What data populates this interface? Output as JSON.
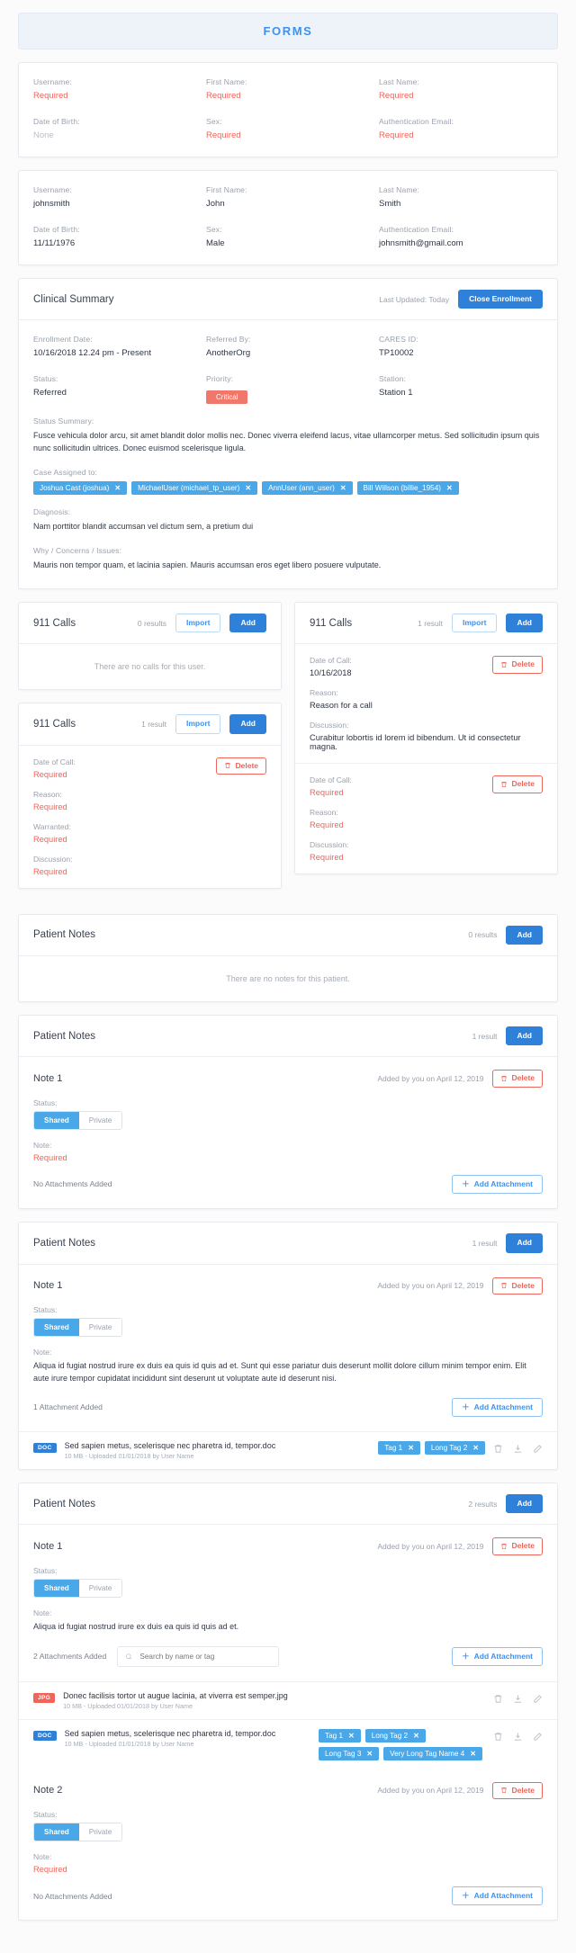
{
  "banner": {
    "title": "FORMS"
  },
  "colors": {
    "accent": "#2f80d8",
    "light_blue": "#4aa8e8",
    "danger": "#f0655a",
    "muted": "#9aa1ad"
  },
  "form_empty": {
    "fields": [
      {
        "label": "Username:",
        "value": "Required",
        "state": "required"
      },
      {
        "label": "First Name:",
        "value": "Required",
        "state": "required"
      },
      {
        "label": "Last Name:",
        "value": "Required",
        "state": "required"
      },
      {
        "label": "Date of Birth:",
        "value": "None",
        "state": "none"
      },
      {
        "label": "Sex:",
        "value": "Required",
        "state": "required"
      },
      {
        "label": "Authentication Email:",
        "value": "Required",
        "state": "required"
      }
    ]
  },
  "form_filled": {
    "fields": [
      {
        "label": "Username:",
        "value": "johnsmith"
      },
      {
        "label": "First Name:",
        "value": "John"
      },
      {
        "label": "Last Name:",
        "value": "Smith"
      },
      {
        "label": "Date of Birth:",
        "value": "11/11/1976"
      },
      {
        "label": "Sex:",
        "value": "Male"
      },
      {
        "label": "Authentication Email:",
        "value": "johnsmith@gmail.com"
      }
    ]
  },
  "clinical_summary": {
    "title": "Clinical Summary",
    "last_updated": "Last Updated: Today",
    "close_button": "Close Enrollment",
    "enrollment_date_label": "Enrollment Date:",
    "enrollment_date_value": "10/16/2018 12.24 pm  -  Present",
    "referred_by_label": "Referred By:",
    "referred_by_value": "AnotherOrg",
    "cares_id_label": "CARES ID:",
    "cares_id_value": "TP10002",
    "status_label": "Status:",
    "status_value": "Referred",
    "priority_label": "Priority:",
    "priority_value": "Critical",
    "station_label": "Station:",
    "station_value": "Station 1",
    "status_summary_label": "Status Summary:",
    "status_summary_text": "Fusce vehicula dolor arcu, sit amet blandit dolor mollis nec. Donec viverra eleifend lacus, vitae ullamcorper metus. Sed sollicitudin ipsum quis nunc sollicitudin ultrices. Donec euismod scelerisque ligula.",
    "case_assigned_label": "Case Assigned to:",
    "case_assigned": [
      "Joshua Cast (joshua)",
      "MichaelUser (michael_tp_user)",
      "AnnUser (ann_user)",
      "Bill Willson (billie_1954)"
    ],
    "diagnosis_label": "Diagnosis:",
    "diagnosis_text": "Nam porttitor blandit accumsan vel dictum sem, a pretium dui",
    "why_label": "Why / Concerns / Issues:",
    "why_text": "Mauris non tempor quam, et lacinia sapien. Mauris accumsan eros eget libero posuere vulputate."
  },
  "calls": {
    "title": "911 Calls",
    "import_label": "Import",
    "add_label": "Add",
    "delete_label": "Delete",
    "empty_message": "There are no calls for this user.",
    "labels": {
      "date": "Date of Call:",
      "reason": "Reason:",
      "warranted": "Warranted:",
      "discussion": "Discussion:"
    },
    "panel_empty": {
      "results": "0 results"
    },
    "panel_required": {
      "results": "1 result",
      "date_value": "Required",
      "reason_value": "Required",
      "warranted_value": "Required",
      "discussion_value": "Required"
    },
    "panel_filled": {
      "results": "1 result",
      "row1": {
        "date_value": "10/16/2018",
        "reason_value": "Reason for a call",
        "discussion_value": "Curabitur lobortis id lorem id bibendum. Ut id consectetur magna."
      },
      "row2": {
        "date_value": "Required",
        "reason_value": "Required",
        "discussion_value": "Required"
      }
    }
  },
  "notes": {
    "title": "Patient Notes",
    "add_label": "Add",
    "delete_label": "Delete",
    "empty_message": "There are no notes for this patient.",
    "status_label": "Status:",
    "note_label": "Note:",
    "shared_label": "Shared",
    "private_label": "Private",
    "add_attachment_label": "Add Attachment",
    "search_placeholder": "Search by name or tag",
    "panel_empty": {
      "results": "0 results"
    },
    "panel_required": {
      "results": "1 result",
      "note_title": "Note 1",
      "added_by": "Added by you on April 12, 2019",
      "note_value": "Required",
      "attachments_text": "No Attachments Added"
    },
    "panel_one_attachment": {
      "results": "1 result",
      "note_title": "Note 1",
      "added_by": "Added by you on April 12, 2019",
      "note_value": "Aliqua id fugiat nostrud irure ex duis ea quis id quis ad et. Sunt qui esse pariatur duis deserunt mollit dolore cillum minim tempor enim. Elit aute irure tempor cupidatat incididunt sint deserunt ut voluptate aute id deserunt nisi.",
      "attachments_text": "1 Attachment Added",
      "attachment": {
        "type": "DOC",
        "name": "Sed sapien metus, scelerisque nec pharetra id, tempor.doc",
        "meta": "10 MB - Uploaded 01/01/2018 by User Name",
        "tags": [
          "Tag 1",
          "Long Tag 2"
        ]
      }
    },
    "panel_two_notes": {
      "results": "2 results",
      "note1": {
        "note_title": "Note 1",
        "added_by": "Added by you on April 12, 2019",
        "note_value": "Aliqua id fugiat nostrud irure ex duis ea quis id quis ad et.",
        "attachments_text": "2 Attachments Added",
        "attachments": [
          {
            "type": "JPG",
            "name": "Donec facilisis tortor ut augue lacinia, at viverra est semper.jpg",
            "meta": "10 MB - Uploaded 01/01/2018 by User Name",
            "tags": []
          },
          {
            "type": "DOC",
            "name": "Sed sapien metus, scelerisque nec pharetra id, tempor.doc",
            "meta": "10 MB - Uploaded 01/01/2018 by User Name",
            "tags": [
              "Tag 1",
              "Long Tag 2",
              "Long Tag 3",
              "Very Long Tag Name 4"
            ]
          }
        ]
      },
      "note2": {
        "note_title": "Note 2",
        "added_by": "Added by you on April 12, 2019",
        "note_value": "Required",
        "attachments_text": "No Attachments Added"
      }
    }
  }
}
